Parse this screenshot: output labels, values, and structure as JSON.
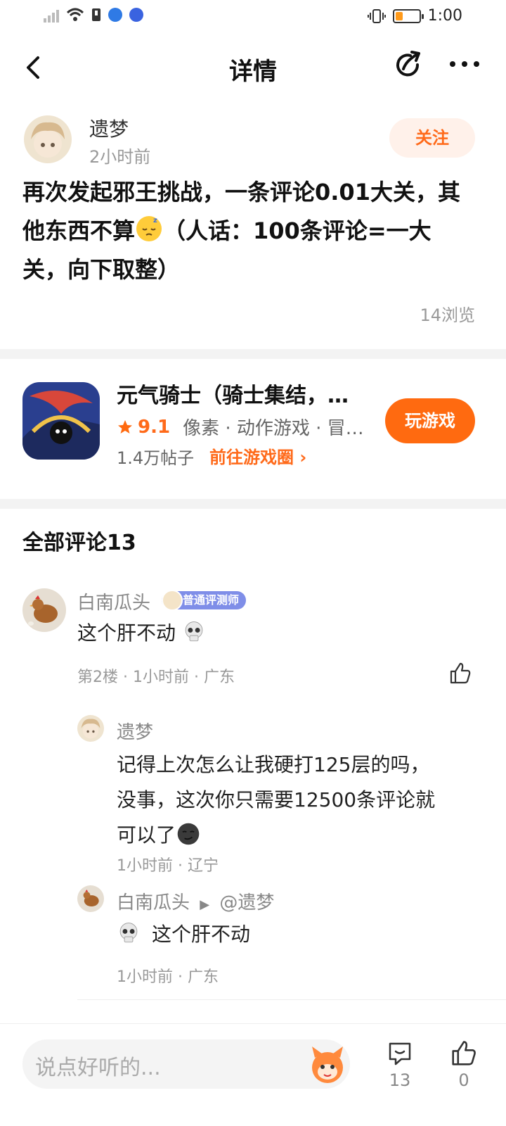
{
  "status": {
    "time": "1:00"
  },
  "header": {
    "title": "详情"
  },
  "post": {
    "author": "遗梦",
    "time": "2小时前",
    "follow_label": "关注",
    "body_part1": "再次发起邪王挑战，一条评论0.01大关，其他东西不算",
    "body_part2": "（人话：100条评论=一大关，向下取整）",
    "views": "14浏览"
  },
  "game": {
    "title": "元气骑士（骑士集结，…",
    "rating": "9.1",
    "tags": "像素 · 动作游戏 · 冒…",
    "posts": "1.4万帖子",
    "link_label": "前往游戏圈 ›",
    "play_label": "玩游戏"
  },
  "comments": {
    "title": "全部评论13",
    "items": [
      {
        "name": "白南瓜头",
        "badge": "普通评测师",
        "text": "这个肝不动",
        "meta": "第2楼 · 1小时前 · 广东"
      }
    ],
    "replies": [
      {
        "name": "遗梦",
        "text_line1": "记得上次怎么让我硬打125层的吗，",
        "text_line2": "没事，这次你只需要12500条评论就",
        "text_line3": "可以了",
        "meta": "1小时前 · 辽宁"
      },
      {
        "name": "白南瓜头",
        "arrow": "▶",
        "target": "@遗梦",
        "text": "这个肝不动",
        "meta": "1小时前 · 广东"
      }
    ]
  },
  "bottom": {
    "placeholder": "说点好听的...",
    "comment_count": "13",
    "like_count": "0"
  },
  "colors": {
    "accent": "#ff6a10",
    "badge": "#7f8ee8"
  }
}
